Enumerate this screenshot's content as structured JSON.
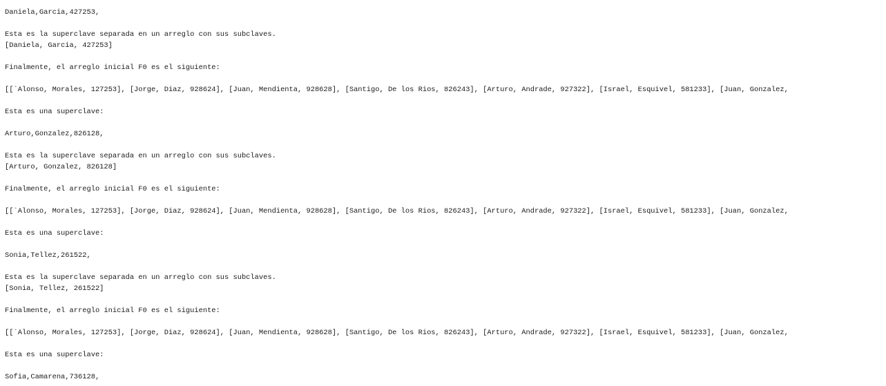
{
  "console": {
    "lines": [
      "Daniela,Garcia,427253,",
      "",
      "Esta es la superclave separada en un arreglo con sus subclaves.",
      "[Daniela, Garcia, 427253]",
      "",
      "Finalmente, el arreglo inicial F0 es el siguiente:",
      "",
      "[[`Alonso, Morales, 127253], [Jorge, Diaz, 928624], [Juan, Mendienta, 928628], [Santigo, De los Rios, 826243], [Arturo, Andrade, 927322], [Israel, Esquivel, 581233], [Juan, Gonzalez,",
      "",
      "Esta es una superclave:",
      "",
      "Arturo,Gonzalez,826128,",
      "",
      "Esta es la superclave separada en un arreglo con sus subclaves.",
      "[Arturo, Gonzalez, 826128]",
      "",
      "Finalmente, el arreglo inicial F0 es el siguiente:",
      "",
      "[[`Alonso, Morales, 127253], [Jorge, Diaz, 928624], [Juan, Mendienta, 928628], [Santigo, De los Rios, 826243], [Arturo, Andrade, 927322], [Israel, Esquivel, 581233], [Juan, Gonzalez,",
      "",
      "Esta es una superclave:",
      "",
      "Sonia,Tellez,261522,",
      "",
      "Esta es la superclave separada en un arreglo con sus subclaves.",
      "[Sonia, Tellez, 261522]",
      "",
      "Finalmente, el arreglo inicial F0 es el siguiente:",
      "",
      "[[`Alonso, Morales, 127253], [Jorge, Diaz, 928624], [Juan, Mendienta, 928628], [Santigo, De los Rios, 826243], [Arturo, Andrade, 927322], [Israel, Esquivel, 581233], [Juan, Gonzalez,",
      "",
      "Esta es una superclave:",
      "",
      "Sofia,Camarena,736128,"
    ]
  }
}
